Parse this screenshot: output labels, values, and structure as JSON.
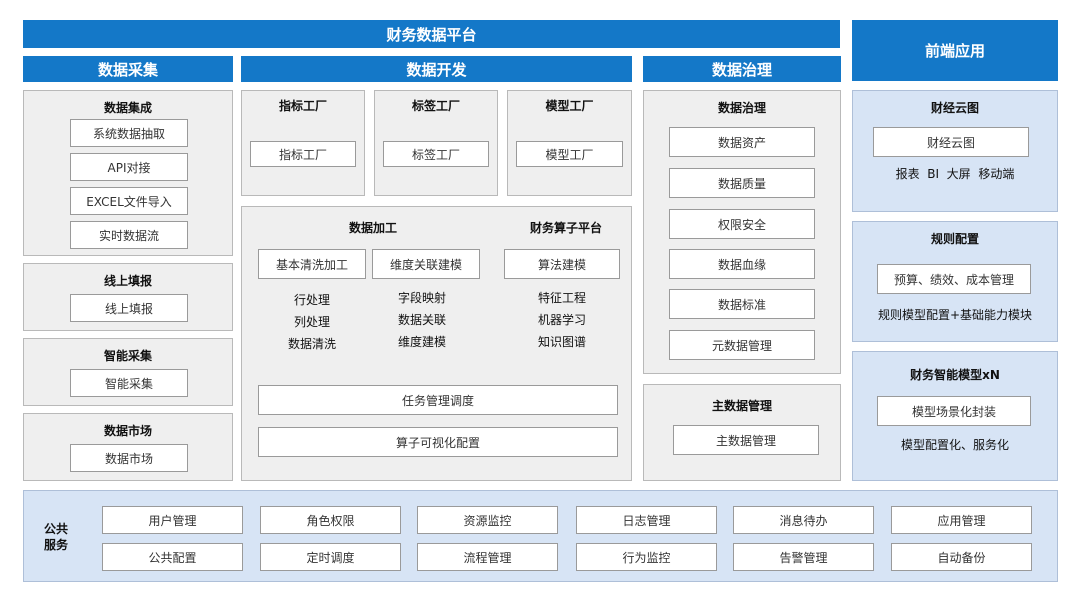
{
  "top": {
    "title": "财务数据平台",
    "frontend": "前端应用"
  },
  "sections": {
    "collect": "数据采集",
    "develop": "数据开发",
    "govern": "数据治理"
  },
  "collect": {
    "integration": {
      "title": "数据集成",
      "items": [
        "系统数据抽取",
        "API对接",
        "EXCEL文件导入",
        "实时数据流"
      ]
    },
    "online": {
      "title": "线上填报",
      "item": "线上填报"
    },
    "smart": {
      "title": "智能采集",
      "item": "智能采集"
    },
    "market": {
      "title": "数据市场",
      "item": "数据市场"
    }
  },
  "develop": {
    "factories": [
      {
        "title": "指标工厂",
        "item": "指标工厂"
      },
      {
        "title": "标签工厂",
        "item": "标签工厂"
      },
      {
        "title": "模型工厂",
        "item": "模型工厂"
      }
    ],
    "processing": {
      "title": "数据加工",
      "clean": "基本清洗加工",
      "dimension": "维度关联建模",
      "clean_items": [
        "行处理",
        "列处理",
        "数据清洗"
      ],
      "dimension_items": [
        "字段映射",
        "数据关联",
        "维度建模"
      ]
    },
    "operator": {
      "title": "财务算子平台",
      "item": "算法建模",
      "items": [
        "特征工程",
        "机器学习",
        "知识图谱"
      ]
    },
    "task": "任务管理调度",
    "visual": "算子可视化配置"
  },
  "govern": {
    "title": "数据治理",
    "items": [
      "数据资产",
      "数据质量",
      "权限安全",
      "数据血缘",
      "数据标准",
      "元数据管理"
    ],
    "master": {
      "title": "主数据管理",
      "item": "主数据管理"
    }
  },
  "frontend": {
    "cloud": {
      "title": "财经云图",
      "item": "财经云图",
      "sub": "报表  BI  大屏  移动端"
    },
    "rules": {
      "title": "规则配置",
      "item": "预算、绩效、成本管理",
      "sub": "规则模型配置+基础能力模块"
    },
    "model": {
      "title": "财务智能模型xN",
      "item": "模型场景化封装",
      "sub": "模型配置化、服务化"
    }
  },
  "public": {
    "label": "公共服务",
    "row1": [
      "用户管理",
      "角色权限",
      "资源监控",
      "日志管理",
      "消息待办",
      "应用管理"
    ],
    "row2": [
      "公共配置",
      "定时调度",
      "流程管理",
      "行为监控",
      "告警管理",
      "自动备份"
    ]
  }
}
